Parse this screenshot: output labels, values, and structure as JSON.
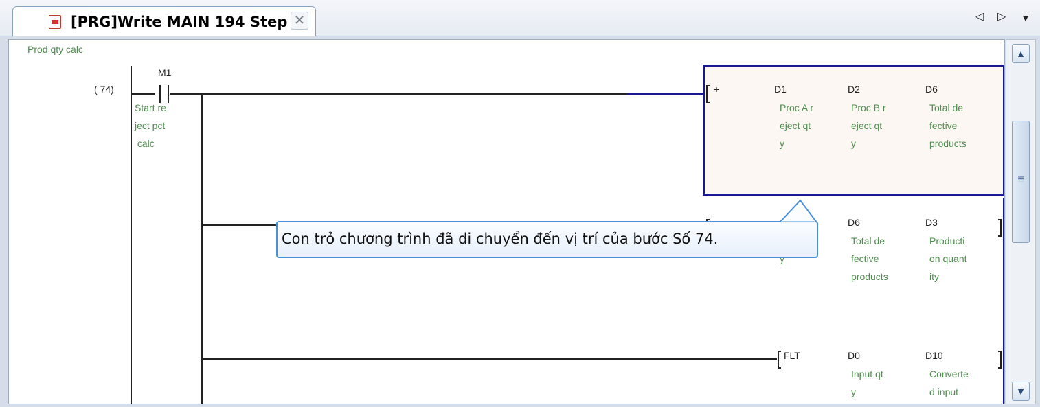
{
  "tab": {
    "title": "[PRG]Write MAIN 194 Step",
    "close_glyph": "✕"
  },
  "nav": {
    "prev_glyph": "◁",
    "next_glyph": "▷",
    "menu_glyph": "▼"
  },
  "ladder": {
    "statement": "Prod qty calc",
    "step": "(   74)",
    "contact": {
      "device": "M1",
      "comment": "Start re\nject pct\n calc"
    },
    "rung1": {
      "instruction": "+",
      "operands": [
        {
          "device": "D1",
          "comment": "Proc A r\neject qt\ny"
        },
        {
          "device": "D2",
          "comment": "Proc B r\neject qt\ny"
        },
        {
          "device": "D6",
          "comment": "Total de\nfective\nproducts"
        }
      ]
    },
    "rung2": {
      "partial_comment": "y",
      "operands": [
        {
          "device": "D6",
          "comment": "Total de\nfective\nproducts"
        },
        {
          "device": "D3",
          "comment": "Producti\non quant\nity"
        }
      ]
    },
    "rung3": {
      "instruction": "FLT",
      "operands": [
        {
          "device": "D0",
          "comment": "Input qt\ny"
        },
        {
          "device": "D10",
          "comment": "Converte\nd input"
        }
      ]
    }
  },
  "callout": {
    "text": "Con trỏ chương trình đã di chuyển đến vị trí của bước Số 74."
  },
  "icons": [
    "program-file-icon",
    "close-icon",
    "scroll-left-icon",
    "scroll-right-icon",
    "dropdown-icon",
    "scroll-up-icon",
    "scroll-down-icon"
  ],
  "colors": {
    "comment": "#4f8d4f",
    "cursor_border": "#1a1890",
    "callout_border": "#4a8fd8"
  }
}
